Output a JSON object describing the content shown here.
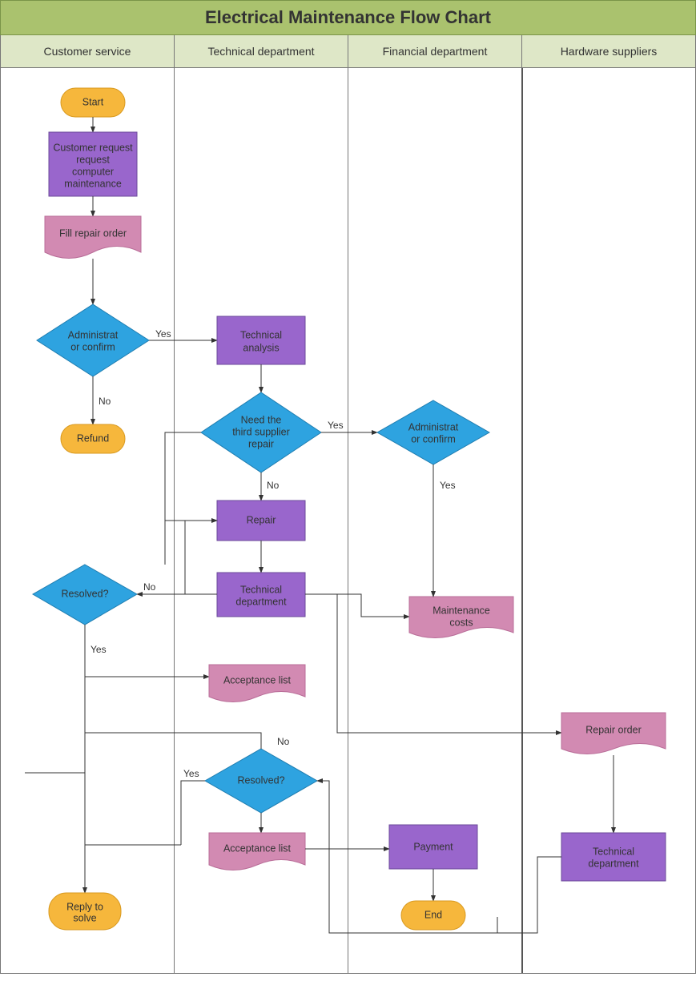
{
  "title": "Electrical Maintenance Flow Chart",
  "lanes": [
    "Customer service",
    "Technical department",
    "Financial department",
    "Hardware suppliers"
  ],
  "nodes": {
    "start": "Start",
    "request1": "Customer request",
    "request2": "computer maintenance",
    "fillOrder": "Fill repair order",
    "adminConfirm1": "Administrat or confirm",
    "refund": "Refund",
    "techAnalysis": "Technical analysis",
    "needSupplier": "Need the third supplier repair",
    "adminConfirm2": "Administrat or confirm",
    "repair": "Repair",
    "techDept1": "Technical department",
    "maintCosts": "Maintenance costs",
    "resolved1": "Resolved?",
    "acceptList1": "Acceptance list",
    "resolved2": "Resolved?",
    "acceptList2": "Acceptance list",
    "payment": "Payment",
    "end": "End",
    "repairOrder": "Repair order",
    "techDept2": "Technical department",
    "reply": "Reply to solve"
  },
  "labels": {
    "yes": "Yes",
    "no": "No"
  },
  "colors": {
    "terminator": "#f6b73c",
    "process": "#9966cc",
    "decision": "#2ea3e0",
    "document": "#d28ab2",
    "laneHeader": "#dee7c7",
    "title": "#aac26e"
  },
  "chart_data": {
    "type": "flowchart-swimlane",
    "title": "Electrical Maintenance Flow Chart",
    "lanes": [
      "Customer service",
      "Technical department",
      "Financial department",
      "Hardware suppliers"
    ],
    "nodes": [
      {
        "id": "start",
        "lane": 0,
        "shape": "terminator",
        "label": "Start"
      },
      {
        "id": "request",
        "lane": 0,
        "shape": "process",
        "label": "Customer request computer maintenance"
      },
      {
        "id": "fillOrder",
        "lane": 0,
        "shape": "document",
        "label": "Fill repair order"
      },
      {
        "id": "adminConfirm1",
        "lane": 0,
        "shape": "decision",
        "label": "Administrator confirm"
      },
      {
        "id": "refund",
        "lane": 0,
        "shape": "terminator",
        "label": "Refund"
      },
      {
        "id": "techAnalysis",
        "lane": 1,
        "shape": "process",
        "label": "Technical analysis"
      },
      {
        "id": "needSupplier",
        "lane": 1,
        "shape": "decision",
        "label": "Need the third supplier repair"
      },
      {
        "id": "adminConfirm2",
        "lane": 2,
        "shape": "decision",
        "label": "Administrator confirm"
      },
      {
        "id": "repair",
        "lane": 1,
        "shape": "process",
        "label": "Repair"
      },
      {
        "id": "techDept1",
        "lane": 1,
        "shape": "process",
        "label": "Technical department"
      },
      {
        "id": "maintCosts",
        "lane": 2,
        "shape": "document",
        "label": "Maintenance costs"
      },
      {
        "id": "resolved1",
        "lane": 0,
        "shape": "decision",
        "label": "Resolved?"
      },
      {
        "id": "acceptList1",
        "lane": 1,
        "shape": "document",
        "label": "Acceptance list"
      },
      {
        "id": "resolved2",
        "lane": 1,
        "shape": "decision",
        "label": "Resolved?"
      },
      {
        "id": "acceptList2",
        "lane": 1,
        "shape": "document",
        "label": "Acceptance list"
      },
      {
        "id": "payment",
        "lane": 2,
        "shape": "process",
        "label": "Payment"
      },
      {
        "id": "end",
        "lane": 2,
        "shape": "terminator",
        "label": "End"
      },
      {
        "id": "repairOrder",
        "lane": 3,
        "shape": "document",
        "label": "Repair order"
      },
      {
        "id": "techDept2",
        "lane": 3,
        "shape": "process",
        "label": "Technical department"
      },
      {
        "id": "reply",
        "lane": 0,
        "shape": "terminator",
        "label": "Reply to solve"
      }
    ],
    "edges": [
      {
        "from": "start",
        "to": "request"
      },
      {
        "from": "request",
        "to": "fillOrder"
      },
      {
        "from": "fillOrder",
        "to": "adminConfirm1"
      },
      {
        "from": "adminConfirm1",
        "to": "techAnalysis",
        "label": "Yes"
      },
      {
        "from": "adminConfirm1",
        "to": "refund",
        "label": "No"
      },
      {
        "from": "techAnalysis",
        "to": "needSupplier"
      },
      {
        "from": "needSupplier",
        "to": "adminConfirm2",
        "label": "Yes"
      },
      {
        "from": "needSupplier",
        "to": "repair",
        "label": "No"
      },
      {
        "from": "adminConfirm2",
        "to": "maintCosts",
        "label": "Yes"
      },
      {
        "from": "repair",
        "to": "techDept1"
      },
      {
        "from": "techDept1",
        "to": "resolved1"
      },
      {
        "from": "resolved1",
        "to": "repair",
        "label": "No"
      },
      {
        "from": "resolved1",
        "to": "acceptList1",
        "label": "Yes"
      },
      {
        "from": "techDept1",
        "to": "repairOrder"
      },
      {
        "from": "repairOrder",
        "to": "techDept2"
      },
      {
        "from": "techDept2",
        "to": "resolved2"
      },
      {
        "from": "resolved2",
        "to": "acceptList2",
        "label": "Yes"
      },
      {
        "from": "resolved2",
        "to": "reply",
        "label": "No"
      },
      {
        "from": "acceptList2",
        "to": "payment"
      },
      {
        "from": "payment",
        "to": "end"
      },
      {
        "from": "acceptList1",
        "to": "reply"
      }
    ]
  }
}
